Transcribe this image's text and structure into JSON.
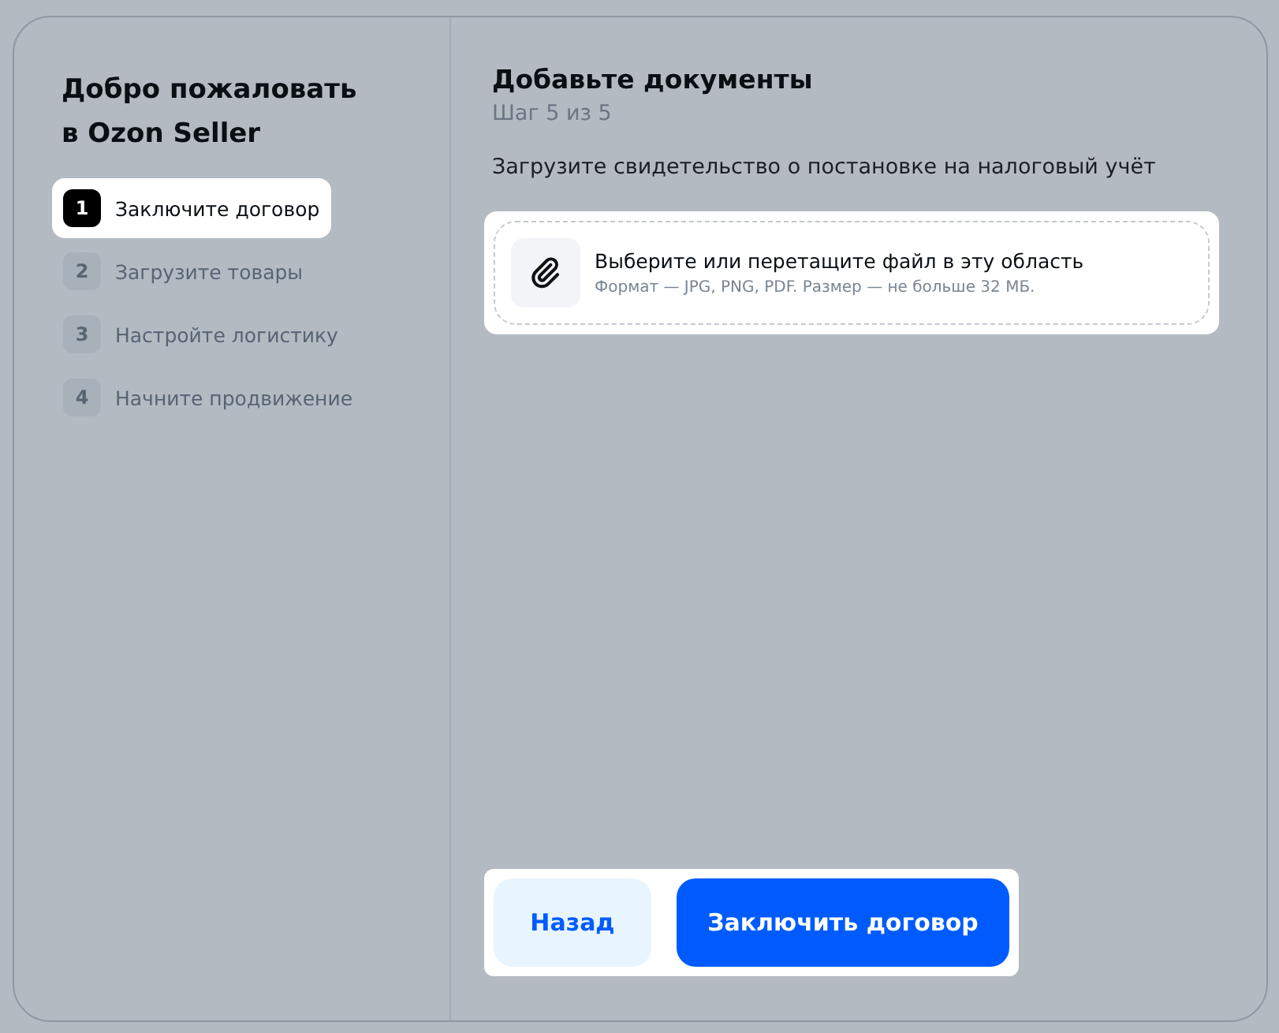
{
  "sidebar": {
    "title_lines": [
      "Добро пожаловать",
      "в Ozon Seller"
    ],
    "steps": [
      {
        "number": "1",
        "label": "Заключите договор",
        "selected": true
      },
      {
        "number": "2",
        "label": "Загрузите товары",
        "selected": false
      },
      {
        "number": "3",
        "label": "Настройте логистику",
        "selected": false
      },
      {
        "number": "4",
        "label": "Начните продвижение",
        "selected": false
      }
    ]
  },
  "main": {
    "title": "Добавьте документы",
    "subtitle": "Шаг 5 из 5",
    "instruction": "Загрузите свидетельство о постановке на налоговый учёт",
    "dropzone": {
      "text": "Выберите или перетащите файл в эту область",
      "hint": "Формат — JPG, PNG, PDF. Размер — не больше 32 МБ."
    },
    "buttons": [
      {
        "kind": "secondary",
        "label": "Назад"
      },
      {
        "kind": "primary",
        "label": "Заключить договор"
      }
    ]
  }
}
